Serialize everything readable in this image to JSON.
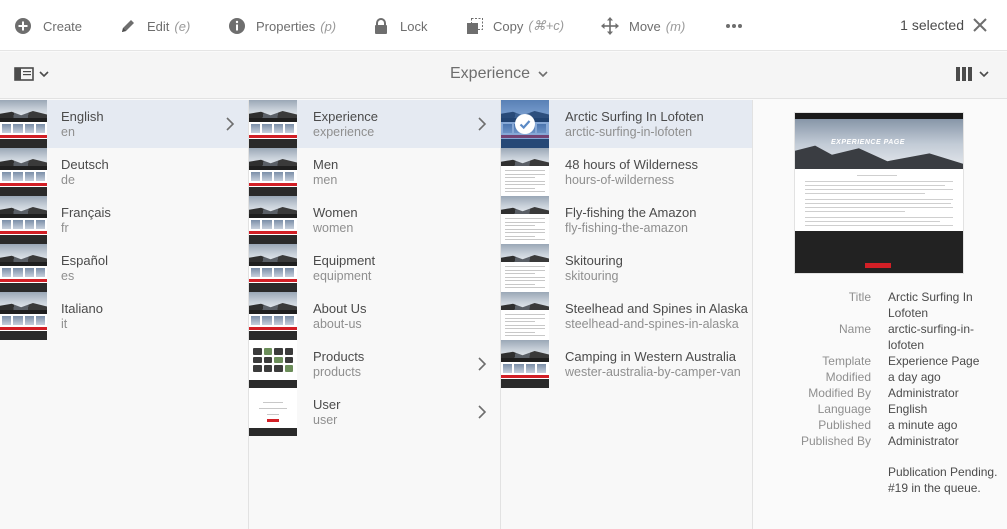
{
  "toolbar": {
    "create": {
      "label": "Create",
      "shortcut": ""
    },
    "edit": {
      "label": "Edit",
      "shortcut": "(e)"
    },
    "properties": {
      "label": "Properties",
      "shortcut": "(p)"
    },
    "lock": {
      "label": "Lock",
      "shortcut": ""
    },
    "copy": {
      "label": "Copy",
      "shortcut": "(⌘+c)"
    },
    "move": {
      "label": "Move",
      "shortcut": "(m)"
    },
    "more_icon": "ellipsis-icon",
    "selected": "1 selected",
    "close_icon": "close-icon"
  },
  "subbar": {
    "title": "Experience"
  },
  "columns": {
    "languages": [
      {
        "title": "English",
        "name": "en",
        "active": true,
        "has_children": true
      },
      {
        "title": "Deutsch",
        "name": "de"
      },
      {
        "title": "Français",
        "name": "fr"
      },
      {
        "title": "Español",
        "name": "es"
      },
      {
        "title": "Italiano",
        "name": "it"
      }
    ],
    "sections": [
      {
        "title": "Experience",
        "name": "experience",
        "active": true,
        "has_children": true
      },
      {
        "title": "Men",
        "name": "men"
      },
      {
        "title": "Women",
        "name": "women"
      },
      {
        "title": "Equipment",
        "name": "equipment"
      },
      {
        "title": "About Us",
        "name": "about-us"
      },
      {
        "title": "Products",
        "name": "products",
        "has_children": true
      },
      {
        "title": "User",
        "name": "user",
        "has_children": true
      }
    ],
    "pages": [
      {
        "title": "Arctic Surfing In Lofoten",
        "name": "arctic-surfing-in-lofoten",
        "selected": true
      },
      {
        "title": "48 hours of Wilderness",
        "name": "hours-of-wilderness"
      },
      {
        "title": "Fly-fishing the Amazon",
        "name": "fly-fishing-the-amazon"
      },
      {
        "title": "Skitouring",
        "name": "skitouring"
      },
      {
        "title": "Steelhead and Spines in Alaska",
        "name": "steelhead-and-spines-in-alaska"
      },
      {
        "title": "Camping in Western Australia",
        "name": "wester-australia-by-camper-van"
      }
    ]
  },
  "details": {
    "preview_heading": "EXPERIENCE PAGE",
    "rows": [
      {
        "key": "Title",
        "value": "Arctic Surfing In Lofoten"
      },
      {
        "key": "Name",
        "value": "arctic-surfing-in-lofoten"
      },
      {
        "key": "Template",
        "value": "Experience Page"
      },
      {
        "key": "Modified",
        "value": "a day ago"
      },
      {
        "key": "Modified By",
        "value": "Administrator"
      },
      {
        "key": "Language",
        "value": "English"
      },
      {
        "key": "Published",
        "value": "a minute ago"
      },
      {
        "key": "Published By",
        "value": "Administrator"
      }
    ],
    "publication_note": "Publication Pending. #19 in the queue."
  },
  "colors": {
    "accent": "#2680eb",
    "active_row": "#e5eaf2",
    "brand_red": "#d21f26"
  }
}
